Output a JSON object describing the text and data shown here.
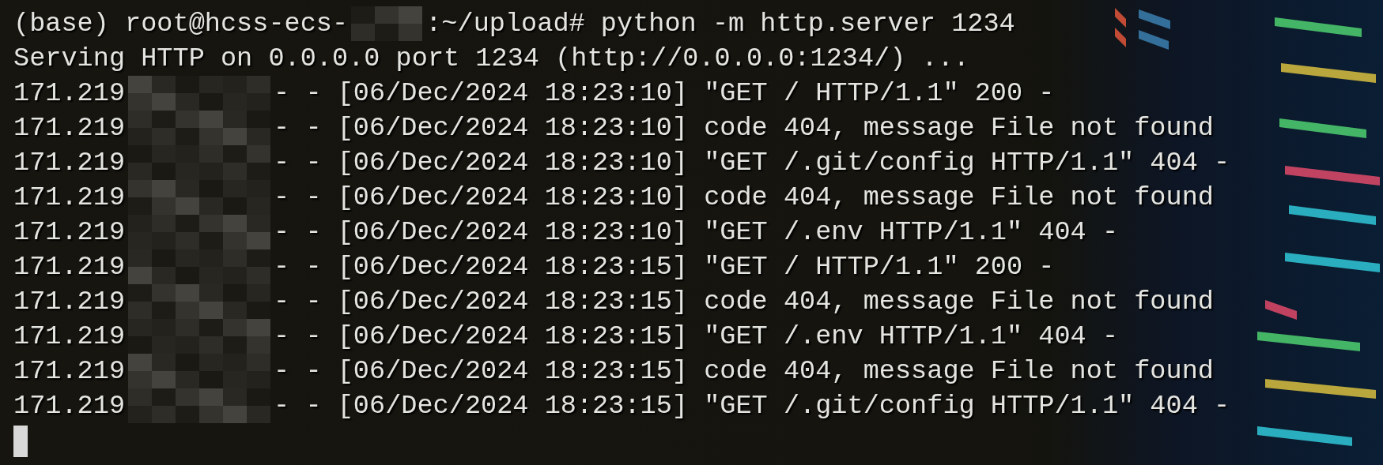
{
  "terminal": {
    "lines": [
      {
        "segments": [
          {
            "kind": "text",
            "text": "(base) root@hcss-ecs-"
          },
          {
            "kind": "redacted-host"
          },
          {
            "kind": "text",
            "text": ":~/upload# python -m http.server 1234"
          }
        ]
      },
      {
        "segments": [
          {
            "kind": "text",
            "text": "Serving HTTP on 0.0.0.0 port 1234 (http://0.0.0.0:1234/) ..."
          }
        ]
      },
      {
        "segments": [
          {
            "kind": "text",
            "text": "171.219"
          },
          {
            "kind": "redacted-ip"
          },
          {
            "kind": "text",
            "text": "- - [06/Dec/2024 18:23:10] \"GET / HTTP/1.1\" 200 -"
          }
        ]
      },
      {
        "segments": [
          {
            "kind": "text",
            "text": "171.219"
          },
          {
            "kind": "redacted-ip"
          },
          {
            "kind": "text",
            "text": "- - [06/Dec/2024 18:23:10] code 404, message File not found"
          }
        ]
      },
      {
        "segments": [
          {
            "kind": "text",
            "text": "171.219"
          },
          {
            "kind": "redacted-ip"
          },
          {
            "kind": "text",
            "text": "- - [06/Dec/2024 18:23:10] \"GET /.git/config HTTP/1.1\" 404 -"
          }
        ]
      },
      {
        "segments": [
          {
            "kind": "text",
            "text": "171.219"
          },
          {
            "kind": "redacted-ip"
          },
          {
            "kind": "text",
            "text": "- - [06/Dec/2024 18:23:10] code 404, message File not found"
          }
        ]
      },
      {
        "segments": [
          {
            "kind": "text",
            "text": "171.219"
          },
          {
            "kind": "redacted-ip"
          },
          {
            "kind": "text",
            "text": "- - [06/Dec/2024 18:23:10] \"GET /.env HTTP/1.1\" 404 -"
          }
        ]
      },
      {
        "segments": [
          {
            "kind": "text",
            "text": "171.219"
          },
          {
            "kind": "redacted-ip"
          },
          {
            "kind": "text",
            "text": "- - [06/Dec/2024 18:23:15] \"GET / HTTP/1.1\" 200 -"
          }
        ]
      },
      {
        "segments": [
          {
            "kind": "text",
            "text": "171.219"
          },
          {
            "kind": "redacted-ip"
          },
          {
            "kind": "text",
            "text": "- - [06/Dec/2024 18:23:15] code 404, message File not found"
          }
        ]
      },
      {
        "segments": [
          {
            "kind": "text",
            "text": "171.219"
          },
          {
            "kind": "redacted-ip"
          },
          {
            "kind": "text",
            "text": "- - [06/Dec/2024 18:23:15] \"GET /.env HTTP/1.1\" 404 -"
          }
        ]
      },
      {
        "segments": [
          {
            "kind": "text",
            "text": "171.219"
          },
          {
            "kind": "redacted-ip"
          },
          {
            "kind": "text",
            "text": "- - [06/Dec/2024 18:23:15] code 404, message File not found"
          }
        ]
      },
      {
        "segments": [
          {
            "kind": "text",
            "text": "171.219"
          },
          {
            "kind": "redacted-ip"
          },
          {
            "kind": "text",
            "text": "- - [06/Dec/2024 18:23:15] \"GET /.git/config HTTP/1.1\" 404 -"
          }
        ]
      }
    ],
    "cursor_visible": true
  }
}
